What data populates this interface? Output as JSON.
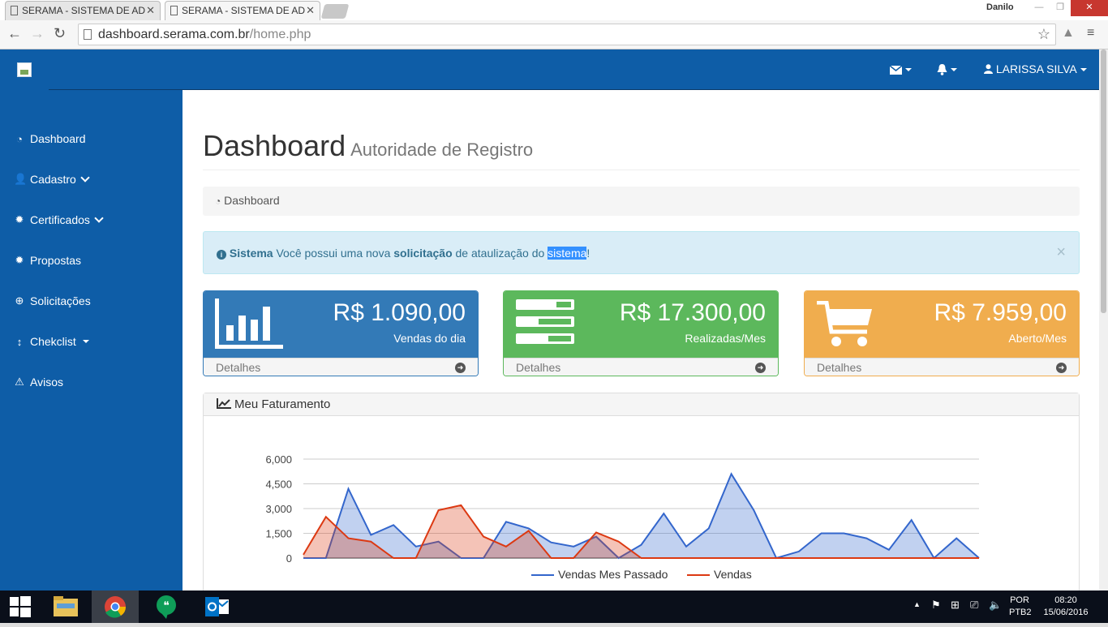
{
  "browser": {
    "tabs": [
      {
        "title": "SERAMA - SISTEMA DE AD",
        "active": false
      },
      {
        "title": "SERAMA - SISTEMA DE AD",
        "active": true
      }
    ],
    "os_user": "Danilo",
    "url_host": "dashboard.serama.com.br",
    "url_path": "/home.php"
  },
  "topnav": {
    "mail_icon": "envelope-icon",
    "bell_icon": "bell-icon",
    "user_name": "LARISSA SILVA"
  },
  "sidebar": {
    "items": [
      {
        "label": "Dashboard",
        "icon": "tachometer-icon",
        "has_chevron": false
      },
      {
        "label": "Cadastro",
        "icon": "user-plus-icon",
        "has_chevron": true
      },
      {
        "label": "Certificados",
        "icon": "certificate-icon",
        "has_chevron": true
      },
      {
        "label": "Propostas",
        "icon": "certificate-icon",
        "has_chevron": false
      },
      {
        "label": "Solicitações",
        "icon": "life-ring-icon",
        "has_chevron": false
      },
      {
        "label": "Chekclist",
        "icon": "arrows-v-icon",
        "has_chevron": true
      },
      {
        "label": "Avisos",
        "icon": "warning-icon",
        "has_chevron": false
      }
    ]
  },
  "page": {
    "title": "Dashboard",
    "subtitle": "Autoridade de Registro",
    "breadcrumb": "Dashboard"
  },
  "alert": {
    "strong": "Sistema",
    "text1": "Você possui uma nova",
    "strong2": "solicitação",
    "text2": "de ataulização do",
    "highlight": "sistema",
    "text3": "!",
    "close": "×"
  },
  "cards": [
    {
      "value": "R$ 1.090,00",
      "label": "Vendas do dia",
      "footer": "Detalhes",
      "color": "#337ab7",
      "icon": "bar-chart-icon"
    },
    {
      "value": "R$ 17.300,00",
      "label": "Realizadas/Mes",
      "footer": "Detalhes",
      "color": "#5cb85c",
      "icon": "tasks-icon"
    },
    {
      "value": "R$ 7.959,00",
      "label": "Aberto/Mes",
      "footer": "Detalhes",
      "color": "#f0ad4e",
      "icon": "shopping-cart-icon"
    }
  ],
  "panel": {
    "title": "Meu Faturamento"
  },
  "chart_data": {
    "type": "area",
    "yticks": [
      "6,000",
      "4,500",
      "3,000",
      "1,500",
      "0"
    ],
    "ylim": [
      0,
      6000
    ],
    "series": [
      {
        "name": "Vendas Mes Passado",
        "color": "#3366cc",
        "values": [
          0,
          0,
          4200,
          1400,
          2000,
          700,
          1000,
          0,
          0,
          2200,
          1800,
          950,
          700,
          1300,
          0,
          800,
          2700,
          700,
          1800,
          5100,
          2900,
          0,
          400,
          1500,
          1500,
          1200,
          500,
          2300,
          0,
          1200,
          0
        ]
      },
      {
        "name": "Vendas",
        "color": "#dc3912",
        "values": [
          200,
          2500,
          1200,
          1000,
          0,
          0,
          2900,
          3200,
          1300,
          700,
          1650,
          0,
          0,
          1550,
          1000,
          0,
          0,
          0,
          0,
          0,
          0,
          0,
          0,
          0,
          0,
          0,
          0,
          0,
          0,
          0,
          0
        ]
      }
    ],
    "legend_position": "bottom"
  },
  "taskbar": {
    "apps": [
      "start-icon",
      "file-explorer-icon",
      "chrome-icon",
      "hangouts-icon",
      "outlook-icon"
    ],
    "lang1": "POR",
    "lang2": "PTB2",
    "time": "08:20",
    "date": "15/06/2016"
  }
}
